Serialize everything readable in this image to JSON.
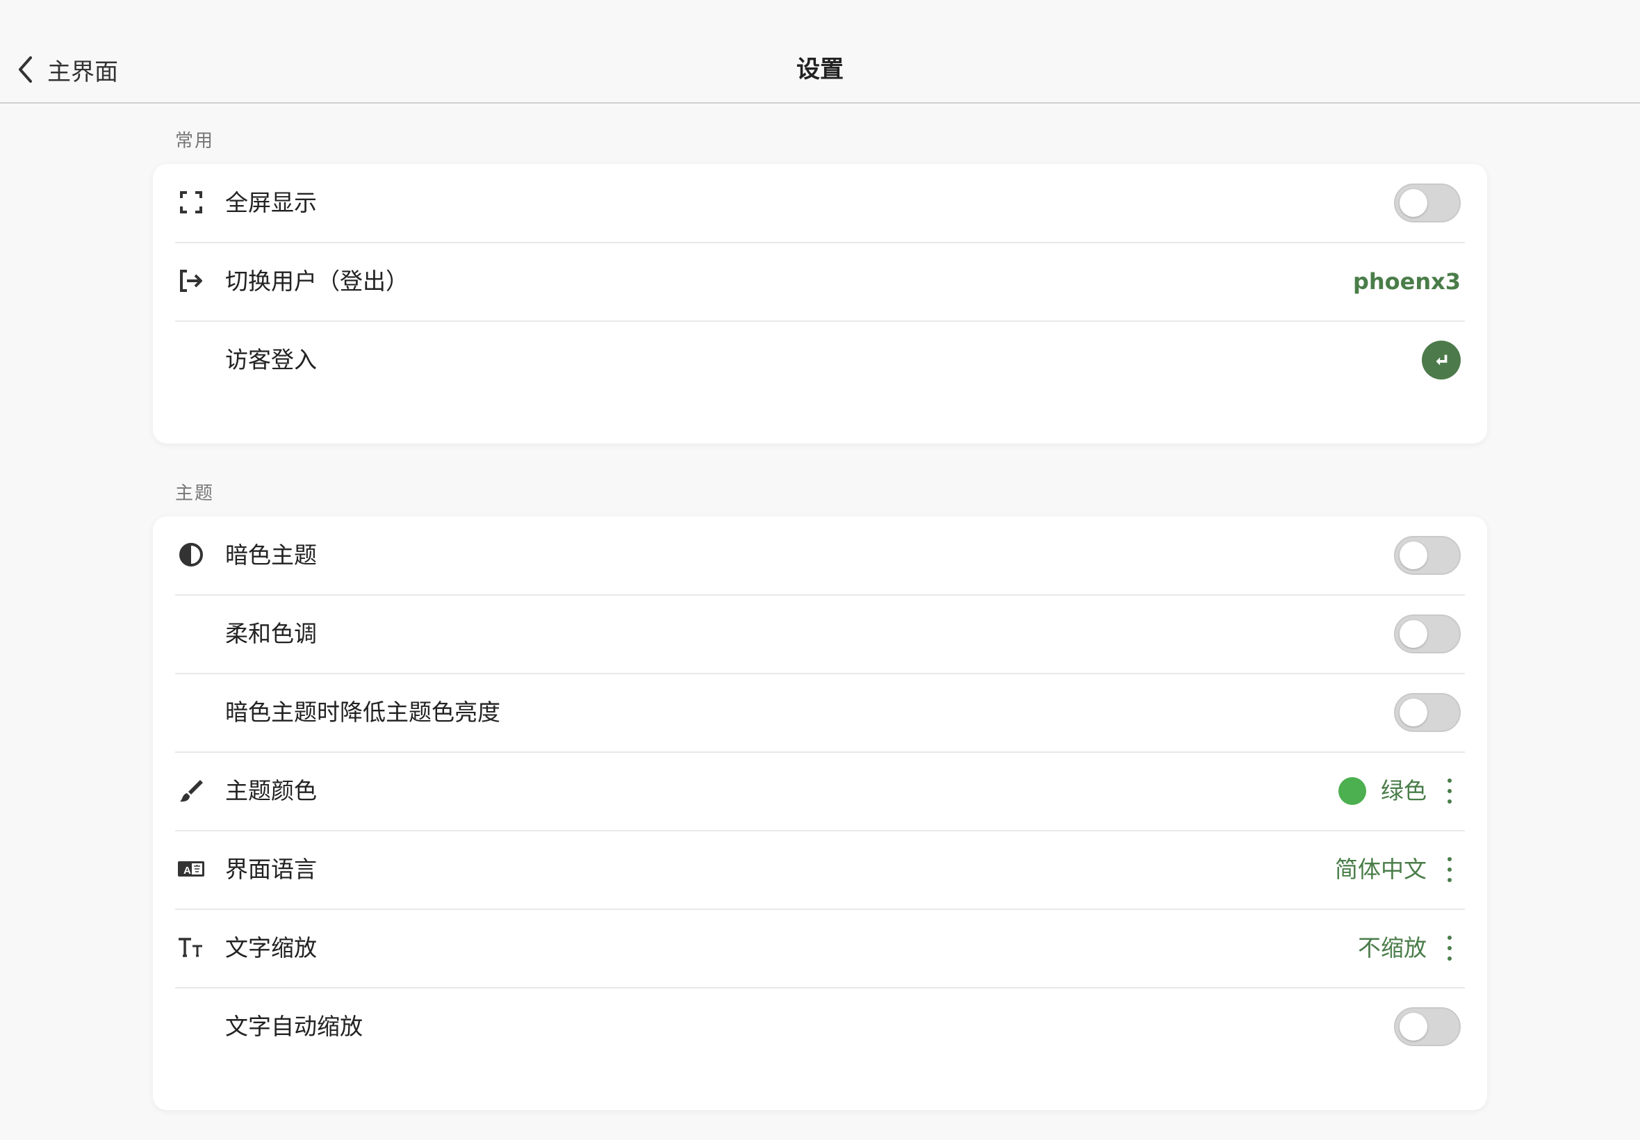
{
  "header": {
    "back_label": "主界面",
    "title": "设置"
  },
  "sections": {
    "common": {
      "label": "常用",
      "fullscreen": {
        "label": "全屏显示",
        "enabled": false
      },
      "switch_user": {
        "label": "切换用户（登出）",
        "value": "phoenx3"
      },
      "guest_login": {
        "label": "访客登入"
      }
    },
    "theme": {
      "label": "主题",
      "dark_theme": {
        "label": "暗色主题",
        "enabled": false
      },
      "soft_tone": {
        "label": "柔和色调",
        "enabled": false
      },
      "dim_in_dark": {
        "label": "暗色主题时降低主题色亮度",
        "enabled": false
      },
      "theme_color": {
        "label": "主题颜色",
        "value": "绿色",
        "swatch_color": "#4caf50"
      },
      "language": {
        "label": "界面语言",
        "value": "简体中文"
      },
      "text_scale": {
        "label": "文字缩放",
        "value": "不缩放"
      },
      "auto_text_scale": {
        "label": "文字自动缩放",
        "enabled": false
      }
    }
  },
  "colors": {
    "accent": "#4a7d49",
    "toggle_off": "#d6d6d6"
  }
}
